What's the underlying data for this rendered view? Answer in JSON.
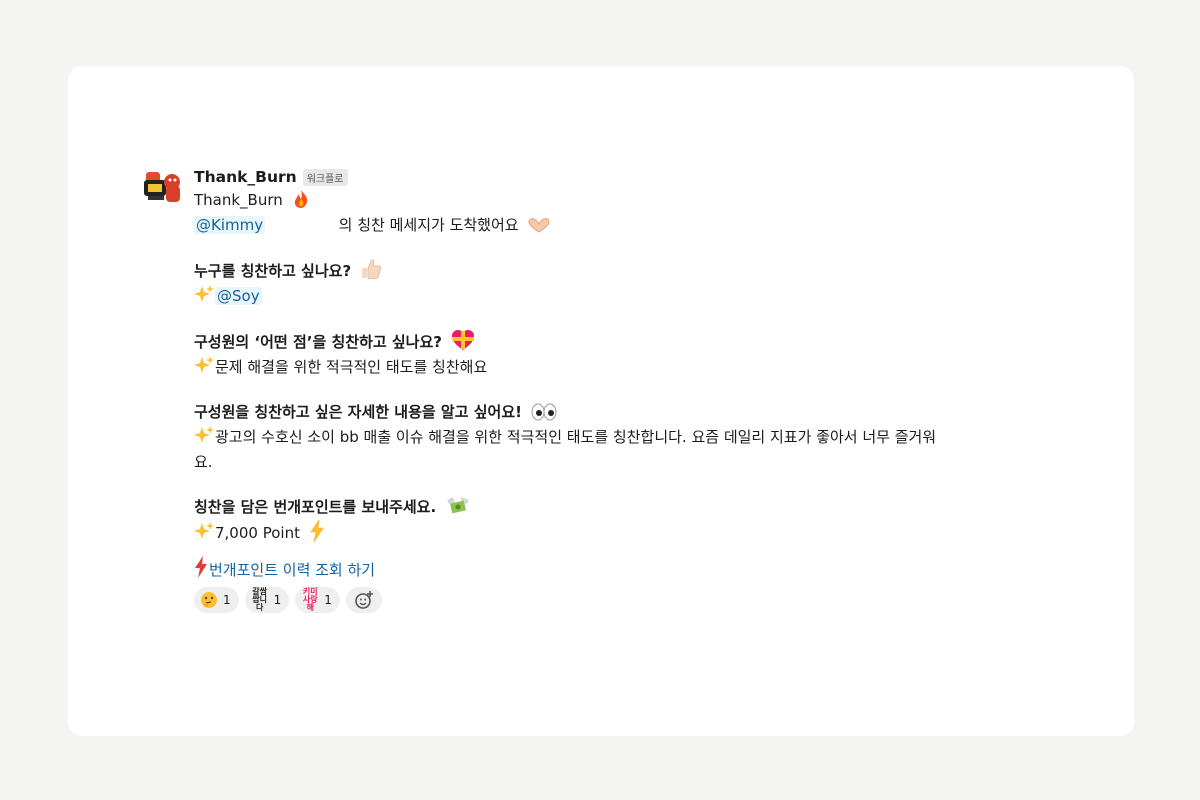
{
  "message": {
    "sender": "Thank_Burn",
    "badge": "워크플로",
    "line1": "Thank_Burn",
    "mention_kimmy": "@Kimmy",
    "line2_text": "의 칭찬 메세지가 도착했어요",
    "q1": "누구를 칭찬하고 싶나요?",
    "a1_mention": "@Soy",
    "q2": "구성원의 ‘어떤 점’을 칭찬하고 싶나요?",
    "a2": "문제 해결을 위한 적극적인 태도를 칭찬해요",
    "q3": "구성원을 칭찬하고 싶은 자세한 내용을 알고 싶어요!",
    "a3": "광고의 수호신 소이 bb 매출 이슈 해결을 위한 적극적인 태도를 칭찬합니다. 요즘 데일리 지표가 좋아서 너무 즐거워요.",
    "q4": "칭찬을 담은 번개포인트를 보내주세요.",
    "a4": "7,000 Point",
    "link": "번개포인트 이력 조회 하기"
  },
  "reactions": [
    {
      "icon": "thinking-face-icon",
      "count": "1"
    },
    {
      "icon_text": "갈쌈\n쌉니다",
      "count": "1"
    },
    {
      "icon_text": "키미\n사랑해",
      "count": "1"
    }
  ],
  "icons": {
    "fire": "fire-icon",
    "hands_heart": "heart-hands-icon",
    "thumbs_up": "thumbs-up-icon",
    "sparkles": "sparkles-icon",
    "heart_ribbon": "heart-with-ribbon-icon",
    "eyes": "eyes-icon",
    "money_wings": "money-with-wings-icon",
    "zap": "high-voltage-icon",
    "lightning_red": "red-lightning-icon",
    "add_reaction": "add-reaction-icon"
  },
  "colors": {
    "link": "#1264a3",
    "mention_bg": "#e8f5fa",
    "reaction_bg": "#efefef",
    "card_bg": "#ffffff",
    "page_bg": "#f4f4f3"
  }
}
